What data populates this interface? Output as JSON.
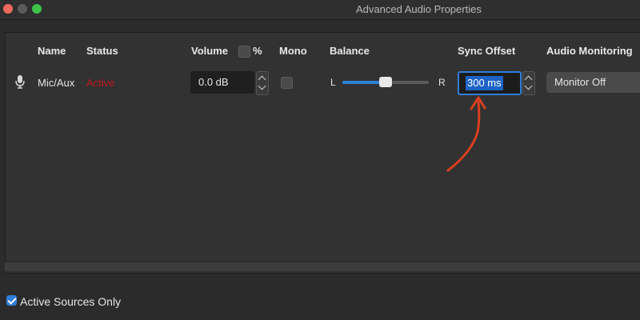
{
  "window": {
    "title": "Advanced Audio Properties"
  },
  "headers": {
    "name": "Name",
    "status": "Status",
    "volume": "Volume",
    "percent": "%",
    "mono": "Mono",
    "balance": "Balance",
    "sync_offset": "Sync Offset",
    "audio_monitoring": "Audio Monitoring"
  },
  "row": {
    "icon": "microphone-icon",
    "name": "Mic/Aux",
    "status": "Active",
    "status_color": "#c0181c",
    "volume_value": "0.0 dB",
    "mono_checked": false,
    "percent_checked": false,
    "balance_left": "L",
    "balance_right": "R",
    "balance_level": 0.5,
    "sync_offset_value": "300 ms",
    "monitoring_value": "Monitor Off"
  },
  "footer": {
    "active_sources_only_label": "Active Sources Only",
    "active_sources_only_checked": true
  },
  "colors": {
    "accent": "#2f7ed8",
    "annotation_arrow": "#d8401e"
  }
}
